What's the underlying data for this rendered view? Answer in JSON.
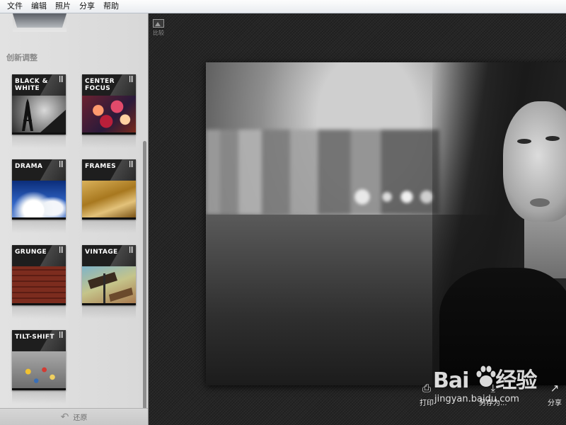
{
  "menu": [
    "文件",
    "编辑",
    "照片",
    "分享",
    "帮助"
  ],
  "sidebar": {
    "section_title": "创新调整",
    "cards": [
      {
        "title": "BLACK &\nWHITE",
        "theme": "black-and-white-photo"
      },
      {
        "title": "CENTER\nFOCUS",
        "theme": "bokeh-lights-photo"
      },
      {
        "title": "DRAMA",
        "theme": "cloud-sky-photo"
      },
      {
        "title": "FRAMES",
        "theme": "paper-frame-photo"
      },
      {
        "title": "GRUNGE",
        "theme": "brick-wall-photo"
      },
      {
        "title": "VINTAGE",
        "theme": "street-sign-photo"
      },
      {
        "title": "TILT-SHIFT",
        "theme": "traffic-photo"
      }
    ],
    "restore_label": "还原"
  },
  "main": {
    "compare_label": "比较",
    "photo_subject": "black-and-white portrait of a woman by the water"
  },
  "toolbar": {
    "print_label": "打印",
    "save_as_label": "另存为...",
    "share_label": "分享"
  },
  "watermark": {
    "logo_text": "Bai",
    "logo_text2": "经验",
    "url": "jingyan.baidu.com"
  },
  "icons": {
    "print": "printer-icon",
    "save_as": "download-icon",
    "share": "share-icon",
    "compare": "image-icon",
    "restore": "undo-arrow-icon"
  },
  "colors": {
    "sidebar_bg": "#dcdcdc",
    "main_bg": "#262626",
    "card_header": "#1e1e1e"
  }
}
